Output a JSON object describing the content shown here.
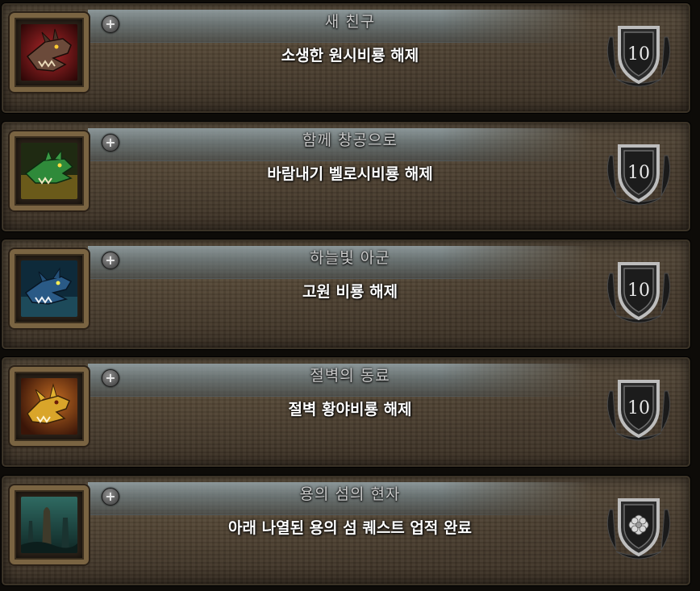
{
  "achievements": [
    {
      "title": "새 친구",
      "description": "소생한 원시비룡 해제",
      "points": "10",
      "icon": "red-drake-icon",
      "icon_color": "#8a1f1f"
    },
    {
      "title": "함께 창공으로",
      "description": "바람내기 벨로시비룡 해제",
      "points": "10",
      "icon": "green-drake-icon",
      "icon_color": "#2f6a2a"
    },
    {
      "title": "하늘빛 아군",
      "description": "고원 비룡 해제",
      "points": "10",
      "icon": "blue-drake-icon",
      "icon_color": "#1f4e7a"
    },
    {
      "title": "절벽의 동료",
      "description": "절벽 황야비룡 해제",
      "points": "10",
      "icon": "yellow-drake-icon",
      "icon_color": "#b07a1a"
    },
    {
      "title": "용의 섬의 현자",
      "description": "아래 나열된 용의 섬 퀘스트 업적 완료",
      "points": "",
      "icon": "forest-landscape-icon",
      "icon_color": "#1f4a44"
    }
  ]
}
